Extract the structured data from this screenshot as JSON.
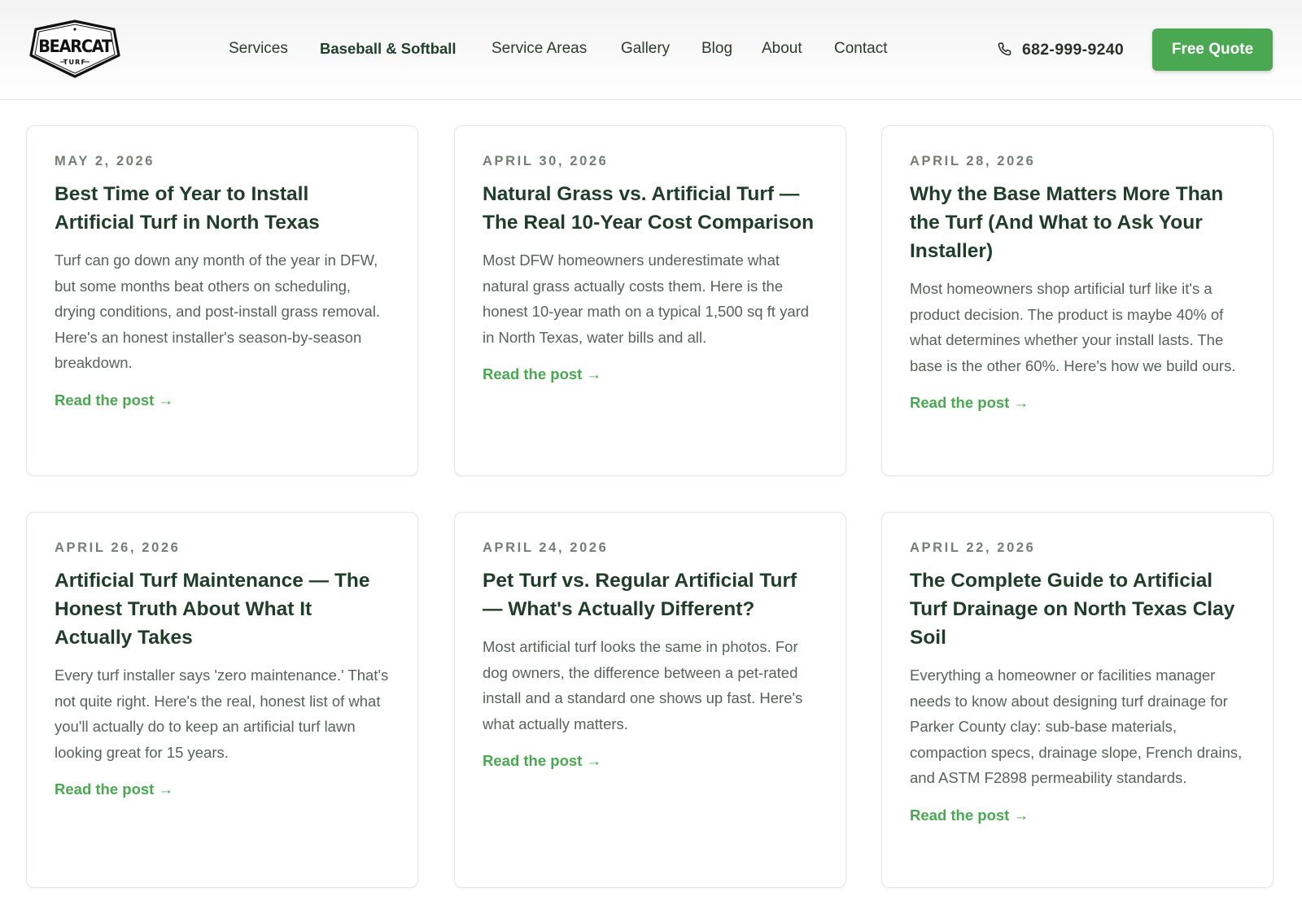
{
  "brand": {
    "logo_word": "BEARCAT",
    "logo_sub": "TURF"
  },
  "nav": {
    "items": [
      {
        "label": "Services"
      },
      {
        "label": "Baseball & Softball"
      },
      {
        "label": "Service Areas"
      },
      {
        "label": "Gallery"
      },
      {
        "label": "Blog"
      },
      {
        "label": "About"
      },
      {
        "label": "Contact"
      }
    ]
  },
  "header": {
    "phone": "682-999-9240",
    "cta_label": "Free Quote"
  },
  "colors": {
    "accent": "#4aa852",
    "heading": "#1f3d28"
  },
  "posts": [
    {
      "date": "May 2, 2026",
      "title": "Best Time of Year to Install Artificial Turf in North Texas",
      "excerpt": "Turf can go down any month of the year in DFW, but some months beat others on scheduling, drying conditions, and post-install grass removal. Here's an honest installer's season-by-season breakdown.",
      "link": "Read the post →"
    },
    {
      "date": "April 30, 2026",
      "title": "Natural Grass vs. Artificial Turf — The Real 10-Year Cost Comparison",
      "excerpt": "Most DFW homeowners underestimate what natural grass actually costs them. Here is the honest 10-year math on a typical 1,500 sq ft yard in North Texas, water bills and all.",
      "link": "Read the post →"
    },
    {
      "date": "April 28, 2026",
      "title": "Why the Base Matters More Than the Turf (And What to Ask Your Installer)",
      "excerpt": "Most homeowners shop artificial turf like it's a product decision. The product is maybe 40% of what determines whether your install lasts. The base is the other 60%. Here's how we build ours.",
      "link": "Read the post →"
    },
    {
      "date": "April 26, 2026",
      "title": "Artificial Turf Maintenance — The Honest Truth About What It Actually Takes",
      "excerpt": "Every turf installer says 'zero maintenance.' That's not quite right. Here's the real, honest list of what you'll actually do to keep an artificial turf lawn looking great for 15 years.",
      "link": "Read the post →"
    },
    {
      "date": "April 24, 2026",
      "title": "Pet Turf vs. Regular Artificial Turf — What's Actually Different?",
      "excerpt": "Most artificial turf looks the same in photos. For dog owners, the difference between a pet-rated install and a standard one shows up fast. Here's what actually matters.",
      "link": "Read the post →"
    },
    {
      "date": "April 22, 2026",
      "title": "The Complete Guide to Artificial Turf Drainage on North Texas Clay Soil",
      "excerpt": "Everything a homeowner or facilities manager needs to know about designing turf drainage for Parker County clay: sub-base materials, compaction specs, drainage slope, French drains, and ASTM F2898 permeability standards.",
      "link": "Read the post →"
    }
  ]
}
